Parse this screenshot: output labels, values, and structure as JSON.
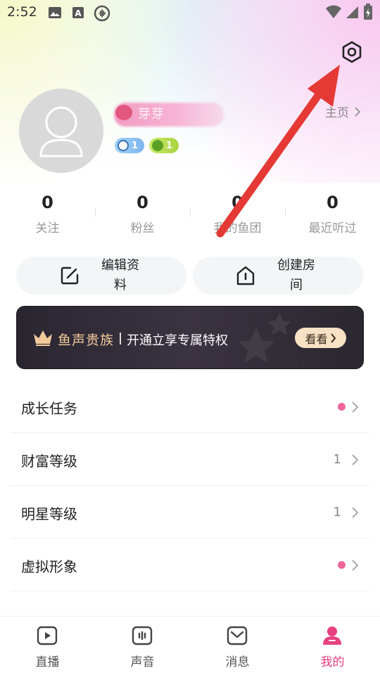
{
  "status_bar": {
    "time": "2:52"
  },
  "profile": {
    "name": "芽芽",
    "badges": [
      {
        "value": "1",
        "color": "#7fb7ef"
      },
      {
        "value": "1",
        "color": "#a9d540"
      }
    ],
    "homepage_label": "主页"
  },
  "stats": [
    {
      "value": "0",
      "label": "关注"
    },
    {
      "value": "0",
      "label": "粉丝"
    },
    {
      "value": "0",
      "label": "我的鱼团"
    },
    {
      "value": "0",
      "label": "最近听过"
    }
  ],
  "actions": {
    "edit_profile": "编辑资料",
    "create_room": "创建房间"
  },
  "vip_banner": {
    "title": "鱼声贵族",
    "subtitle": "开通立享专属特权",
    "button": "看看"
  },
  "menu": [
    {
      "label": "成长任务",
      "value": "",
      "dot": true
    },
    {
      "label": "财富等级",
      "value": "1",
      "dot": false
    },
    {
      "label": "明星等级",
      "value": "1",
      "dot": false
    },
    {
      "label": "虚拟形象",
      "value": "",
      "dot": true
    }
  ],
  "bottom_nav": [
    {
      "label": "直播",
      "icon": "live-play-icon",
      "active": false
    },
    {
      "label": "声音",
      "icon": "voice-icon",
      "active": false
    },
    {
      "label": "消息",
      "icon": "message-icon",
      "active": false
    },
    {
      "label": "我的",
      "icon": "profile-icon",
      "active": true
    }
  ],
  "colors": {
    "accent": "#e6407f",
    "annotation_arrow": "#e53935",
    "vip_gold": "#f2c99b"
  }
}
